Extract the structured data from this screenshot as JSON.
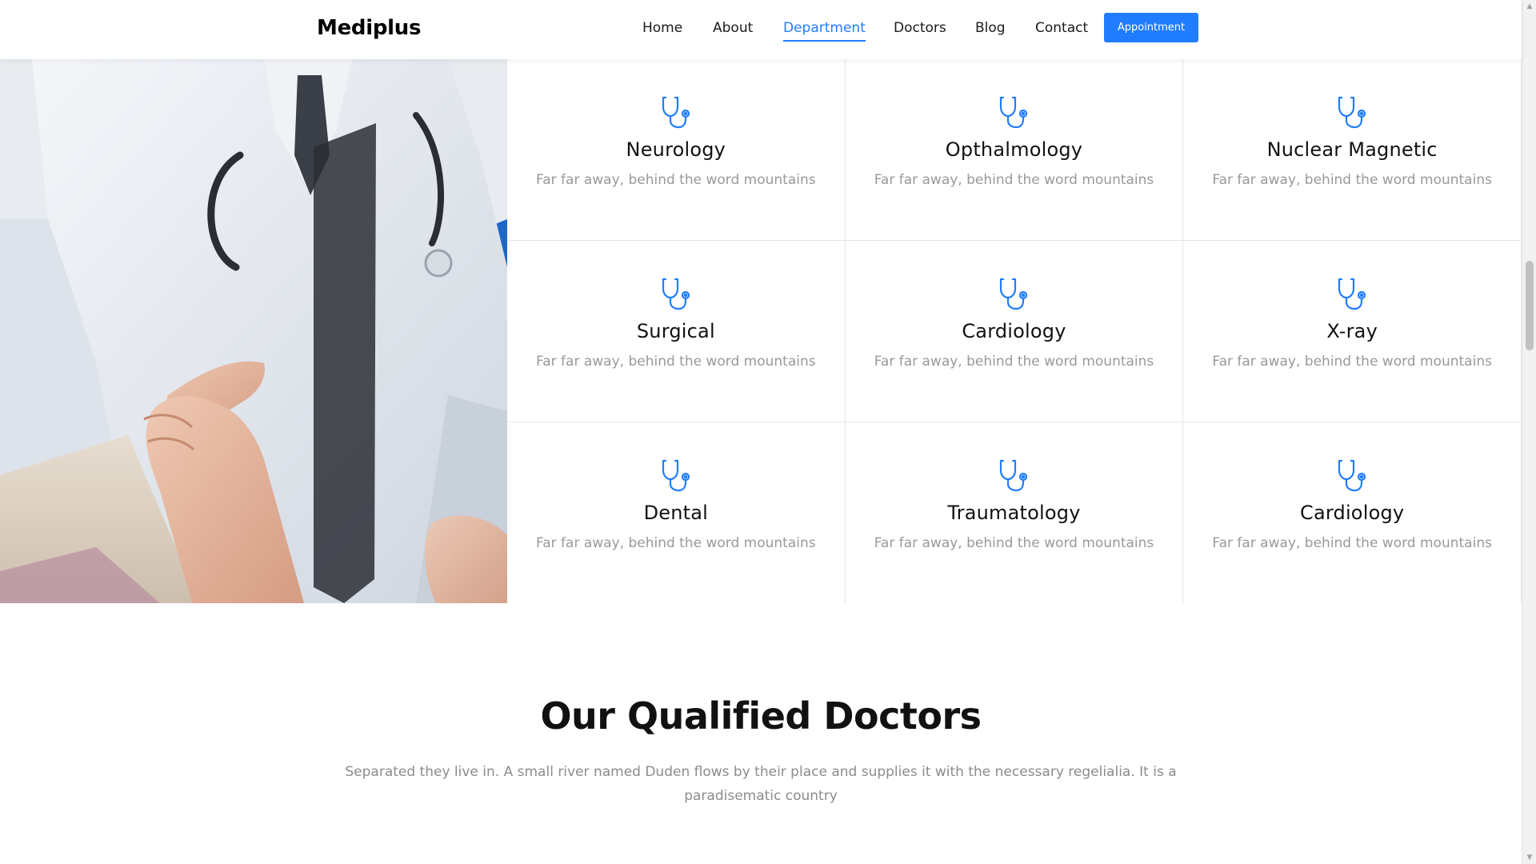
{
  "brand": "Mediplus",
  "nav": {
    "items": [
      {
        "label": "Home"
      },
      {
        "label": "About"
      },
      {
        "label": "Department"
      },
      {
        "label": "Doctors"
      },
      {
        "label": "Blog"
      },
      {
        "label": "Contact"
      }
    ],
    "active": "Department",
    "appointment_label": "Appointment"
  },
  "colors": {
    "accent": "#207dff"
  },
  "hero_image": {
    "alt": "doctor shaking hands with patient"
  },
  "departments": [
    {
      "title": "Neurology",
      "desc": "Far far away, behind the word mountains",
      "icon": "stethoscope-icon"
    },
    {
      "title": "Opthalmology",
      "desc": "Far far away, behind the word mountains",
      "icon": "stethoscope-icon"
    },
    {
      "title": "Nuclear Magnetic",
      "desc": "Far far away, behind the word mountains",
      "icon": "stethoscope-icon"
    },
    {
      "title": "Surgical",
      "desc": "Far far away, behind the word mountains",
      "icon": "stethoscope-icon"
    },
    {
      "title": "Cardiology",
      "desc": "Far far away, behind the word mountains",
      "icon": "stethoscope-icon"
    },
    {
      "title": "X-ray",
      "desc": "Far far away, behind the word mountains",
      "icon": "stethoscope-icon"
    },
    {
      "title": "Dental",
      "desc": "Far far away, behind the word mountains",
      "icon": "stethoscope-icon"
    },
    {
      "title": "Traumatology",
      "desc": "Far far away, behind the word mountains",
      "icon": "stethoscope-icon"
    },
    {
      "title": "Cardiology",
      "desc": "Far far away, behind the word mountains",
      "icon": "stethoscope-icon"
    }
  ],
  "doctors_section": {
    "heading": "Our Qualified Doctors",
    "subtext": "Separated they live in. A small river named Duden flows by their place and supplies it with the necessary regelialia. It is a paradisematic country"
  }
}
